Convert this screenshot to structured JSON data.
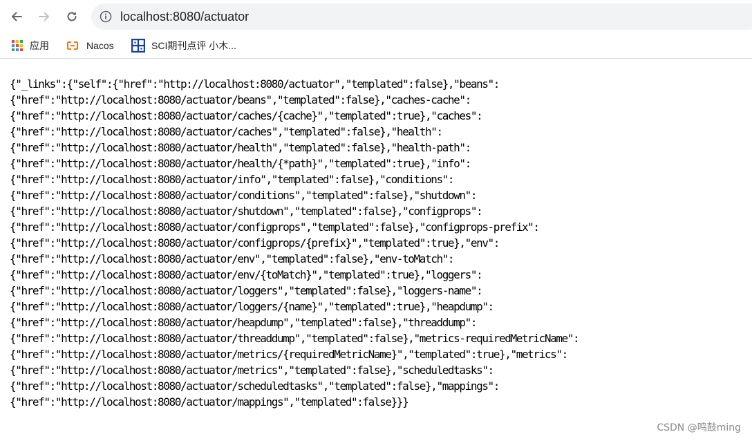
{
  "browser": {
    "address_bar": {
      "url": "localhost:8080/actuator"
    },
    "bookmarks": [
      {
        "label": "应用",
        "icon": "apps-grid-icon"
      },
      {
        "label": "Nacos",
        "icon": "nacos-logo-icon"
      },
      {
        "label": "SCI期刊点评 小木...",
        "icon": "sci-journal-icon"
      }
    ]
  },
  "page": {
    "json_lines": [
      "{\"_links\":{\"self\":{\"href\":\"http://localhost:8080/actuator\",\"templated\":false},\"beans\":",
      "{\"href\":\"http://localhost:8080/actuator/beans\",\"templated\":false},\"caches-cache\":",
      "{\"href\":\"http://localhost:8080/actuator/caches/{cache}\",\"templated\":true},\"caches\":",
      "{\"href\":\"http://localhost:8080/actuator/caches\",\"templated\":false},\"health\":",
      "{\"href\":\"http://localhost:8080/actuator/health\",\"templated\":false},\"health-path\":",
      "{\"href\":\"http://localhost:8080/actuator/health/{*path}\",\"templated\":true},\"info\":",
      "{\"href\":\"http://localhost:8080/actuator/info\",\"templated\":false},\"conditions\":",
      "{\"href\":\"http://localhost:8080/actuator/conditions\",\"templated\":false},\"shutdown\":",
      "{\"href\":\"http://localhost:8080/actuator/shutdown\",\"templated\":false},\"configprops\":",
      "{\"href\":\"http://localhost:8080/actuator/configprops\",\"templated\":false},\"configprops-prefix\":",
      "{\"href\":\"http://localhost:8080/actuator/configprops/{prefix}\",\"templated\":true},\"env\":",
      "{\"href\":\"http://localhost:8080/actuator/env\",\"templated\":false},\"env-toMatch\":",
      "{\"href\":\"http://localhost:8080/actuator/env/{toMatch}\",\"templated\":true},\"loggers\":",
      "{\"href\":\"http://localhost:8080/actuator/loggers\",\"templated\":false},\"loggers-name\":",
      "{\"href\":\"http://localhost:8080/actuator/loggers/{name}\",\"templated\":true},\"heapdump\":",
      "{\"href\":\"http://localhost:8080/actuator/heapdump\",\"templated\":false},\"threaddump\":",
      "{\"href\":\"http://localhost:8080/actuator/threaddump\",\"templated\":false},\"metrics-requiredMetricName\":",
      "{\"href\":\"http://localhost:8080/actuator/metrics/{requiredMetricName}\",\"templated\":true},\"metrics\":",
      "{\"href\":\"http://localhost:8080/actuator/metrics\",\"templated\":false},\"scheduledtasks\":",
      "{\"href\":\"http://localhost:8080/actuator/scheduledtasks\",\"templated\":false},\"mappings\":",
      "{\"href\":\"http://localhost:8080/actuator/mappings\",\"templated\":false}}}"
    ]
  },
  "watermark": "CSDN @鸣鼓ming"
}
